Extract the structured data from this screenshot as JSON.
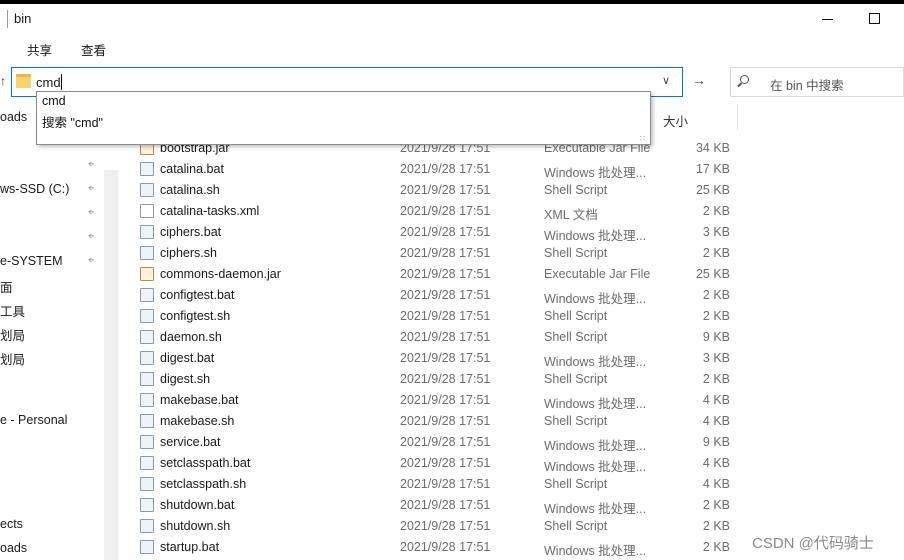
{
  "window": {
    "title": "bin"
  },
  "ribbon": {
    "tabs": [
      "共享",
      "查看"
    ]
  },
  "address": {
    "value": "cmd"
  },
  "search": {
    "placeholder": "在 bin 中搜索"
  },
  "suggestions": [
    "cmd",
    "搜索 \"cmd\""
  ],
  "nav": [
    {
      "label": "oads",
      "pinned": false
    },
    {
      "label": "",
      "pinned": true
    },
    {
      "label": "ws-SSD (C:)",
      "pinned": true
    },
    {
      "label": "",
      "pinned": true
    },
    {
      "label": "",
      "pinned": true
    },
    {
      "label": "e-SYSTEM",
      "pinned": true
    },
    {
      "label": "面",
      "pinned": false
    },
    {
      "label": "工具",
      "pinned": false
    },
    {
      "label": "划局",
      "pinned": false
    },
    {
      "label": "划局",
      "pinned": false
    },
    {
      "label": "e - Personal",
      "pinned": false
    },
    {
      "label": "ects",
      "pinned": false
    },
    {
      "label": "oads",
      "pinned": false
    }
  ],
  "columns": {
    "size": "大小"
  },
  "files": [
    {
      "name": "bootstrap.jar",
      "date": "2021/9/28 17:51",
      "type": "Executable Jar File",
      "size": "34 KB",
      "icon": "jar-icon"
    },
    {
      "name": "catalina.bat",
      "date": "2021/9/28 17:51",
      "type": "Windows 批处理...",
      "size": "17 KB",
      "icon": "batch-file-icon"
    },
    {
      "name": "catalina.sh",
      "date": "2021/9/28 17:51",
      "type": "Shell Script",
      "size": "25 KB",
      "icon": "script-file-icon"
    },
    {
      "name": "catalina-tasks.xml",
      "date": "2021/9/28 17:51",
      "type": "XML 文档",
      "size": "2 KB",
      "icon": "xml-file-icon"
    },
    {
      "name": "ciphers.bat",
      "date": "2021/9/28 17:51",
      "type": "Windows 批处理...",
      "size": "3 KB",
      "icon": "batch-file-icon"
    },
    {
      "name": "ciphers.sh",
      "date": "2021/9/28 17:51",
      "type": "Shell Script",
      "size": "2 KB",
      "icon": "script-file-icon"
    },
    {
      "name": "commons-daemon.jar",
      "date": "2021/9/28 17:51",
      "type": "Executable Jar File",
      "size": "25 KB",
      "icon": "jar-icon"
    },
    {
      "name": "configtest.bat",
      "date": "2021/9/28 17:51",
      "type": "Windows 批处理...",
      "size": "2 KB",
      "icon": "batch-file-icon"
    },
    {
      "name": "configtest.sh",
      "date": "2021/9/28 17:51",
      "type": "Shell Script",
      "size": "2 KB",
      "icon": "script-file-icon"
    },
    {
      "name": "daemon.sh",
      "date": "2021/9/28 17:51",
      "type": "Shell Script",
      "size": "9 KB",
      "icon": "script-file-icon"
    },
    {
      "name": "digest.bat",
      "date": "2021/9/28 17:51",
      "type": "Windows 批处理...",
      "size": "3 KB",
      "icon": "batch-file-icon"
    },
    {
      "name": "digest.sh",
      "date": "2021/9/28 17:51",
      "type": "Shell Script",
      "size": "2 KB",
      "icon": "script-file-icon"
    },
    {
      "name": "makebase.bat",
      "date": "2021/9/28 17:51",
      "type": "Windows 批处理...",
      "size": "4 KB",
      "icon": "batch-file-icon"
    },
    {
      "name": "makebase.sh",
      "date": "2021/9/28 17:51",
      "type": "Shell Script",
      "size": "4 KB",
      "icon": "script-file-icon"
    },
    {
      "name": "service.bat",
      "date": "2021/9/28 17:51",
      "type": "Windows 批处理...",
      "size": "9 KB",
      "icon": "batch-file-icon"
    },
    {
      "name": "setclasspath.bat",
      "date": "2021/9/28 17:51",
      "type": "Windows 批处理...",
      "size": "4 KB",
      "icon": "batch-file-icon"
    },
    {
      "name": "setclasspath.sh",
      "date": "2021/9/28 17:51",
      "type": "Shell Script",
      "size": "4 KB",
      "icon": "script-file-icon"
    },
    {
      "name": "shutdown.bat",
      "date": "2021/9/28 17:51",
      "type": "Windows 批处理...",
      "size": "2 KB",
      "icon": "batch-file-icon"
    },
    {
      "name": "shutdown.sh",
      "date": "2021/9/28 17:51",
      "type": "Shell Script",
      "size": "2 KB",
      "icon": "script-file-icon"
    },
    {
      "name": "startup.bat",
      "date": "2021/9/28 17:51",
      "type": "Windows 批处理...",
      "size": "2 KB",
      "icon": "batch-file-icon"
    }
  ],
  "watermark": "CSDN @代码骑士",
  "colors": {
    "accent": "#0078d7",
    "folder": "#f7d36a"
  }
}
